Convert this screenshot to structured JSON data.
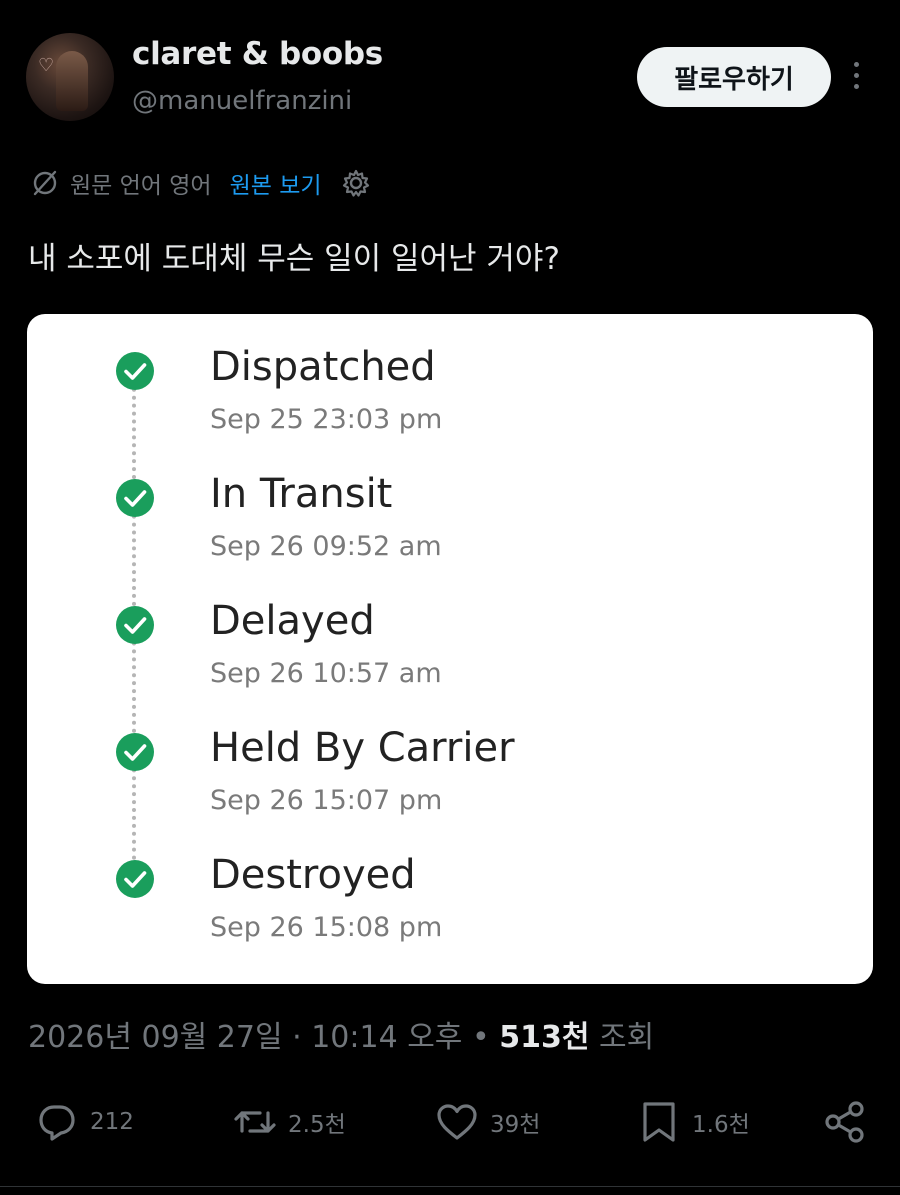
{
  "author": {
    "display_name": "claret & boobs",
    "handle": "@manuelfranzini"
  },
  "follow_button": {
    "label": "팔로우하기"
  },
  "translation": {
    "original_language": "원문 언어 영어",
    "view_original": "원본 보기"
  },
  "tweet": {
    "text": "내 소포에 도대체 무슨 일이 일어난 거야?"
  },
  "tracking": {
    "steps": [
      {
        "status": "Dispatched",
        "time": "Sep 25 23:03 pm"
      },
      {
        "status": "In Transit",
        "time": "Sep 26 09:52 am"
      },
      {
        "status": "Delayed",
        "time": "Sep 26 10:57 am"
      },
      {
        "status": "Held By Carrier",
        "time": "Sep 26 15:07 pm"
      },
      {
        "status": "Destroyed",
        "time": "Sep 26 15:08 pm"
      }
    ],
    "check_color": "#1a9e5c"
  },
  "meta": {
    "date": "2026년 09월 27일",
    "separator": "·",
    "time": "10:14 오후",
    "views_count": "513천",
    "views_label": "조회"
  },
  "actions": {
    "replies": "212",
    "reposts": "2.5천",
    "likes": "39천",
    "bookmarks": "1.6천"
  },
  "colors": {
    "background": "#000000",
    "link": "#1d9bf0",
    "muted": "#71767b"
  },
  "icons": [
    "more-icon",
    "globe-slash-icon",
    "gear-icon",
    "check-icon",
    "reply-icon",
    "repost-icon",
    "like-icon",
    "bookmark-icon",
    "share-icon"
  ]
}
